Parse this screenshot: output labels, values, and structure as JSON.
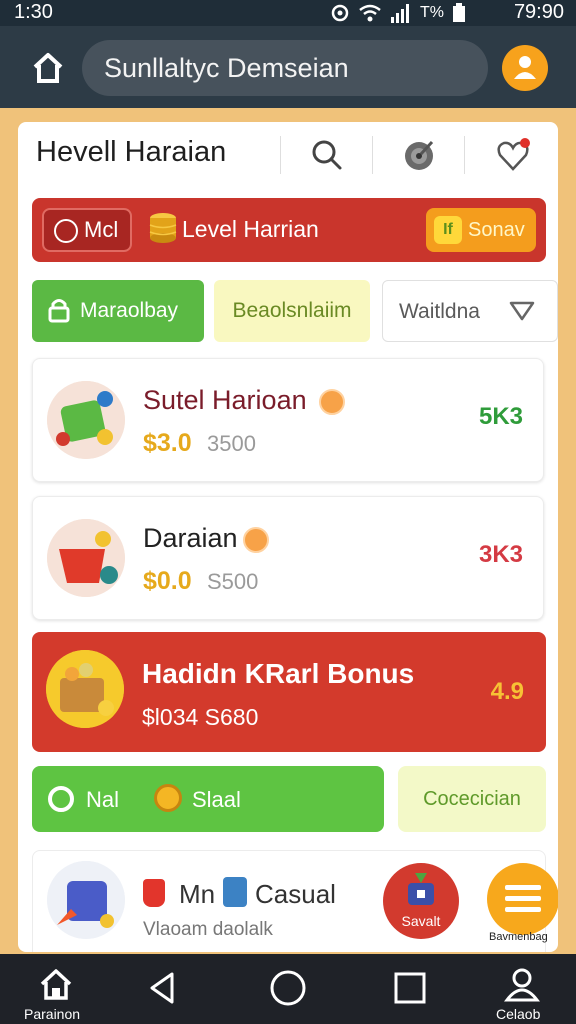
{
  "status_bar": {
    "time": "1:30",
    "battery_text": "T%",
    "clock": "79:90"
  },
  "app_bar": {
    "search_text": "Sunllaltyc Demseian"
  },
  "panel": {
    "title": "Hevell Haraian"
  },
  "level_banner": {
    "chip_label": "Mcl",
    "label": "Level Harrian",
    "badge": "If",
    "button_label": "Sonav"
  },
  "tabs": [
    {
      "label": "Maraolbay"
    },
    {
      "label": "Beaolsnlaiim"
    },
    {
      "label": "Waitldna"
    }
  ],
  "cards": [
    {
      "title": "Sutel Harioan",
      "price": "$3.0",
      "price_sub": "3500",
      "score": "5K3"
    },
    {
      "title": "Daraian",
      "price": "$0.0",
      "price_sub": "S500",
      "score": "3K3"
    }
  ],
  "bonus": {
    "title": "Hadidn KRarl Bonus",
    "price": "$l034 S680",
    "score": "4.9"
  },
  "green_bar": {
    "label_1": "Nal",
    "label_2": "Slaal"
  },
  "cocoa_button": {
    "label": "Cocecician"
  },
  "bottom_card": {
    "title_1": "Mn",
    "title_2": "Casual",
    "subtitle": "Vlaoam daolalk",
    "button_label": "Savalt",
    "fab_label": "Bavmenbag"
  },
  "nav": {
    "home_label": "Parainon",
    "profile_label": "Celaob"
  },
  "colors": {
    "app_bar": "#2d3b46",
    "accent_orange": "#f7a21c",
    "banner_red": "#c9352c",
    "bonus_red": "#d33a2c",
    "green": "#5ec442",
    "price_gold": "#e6a91c"
  }
}
